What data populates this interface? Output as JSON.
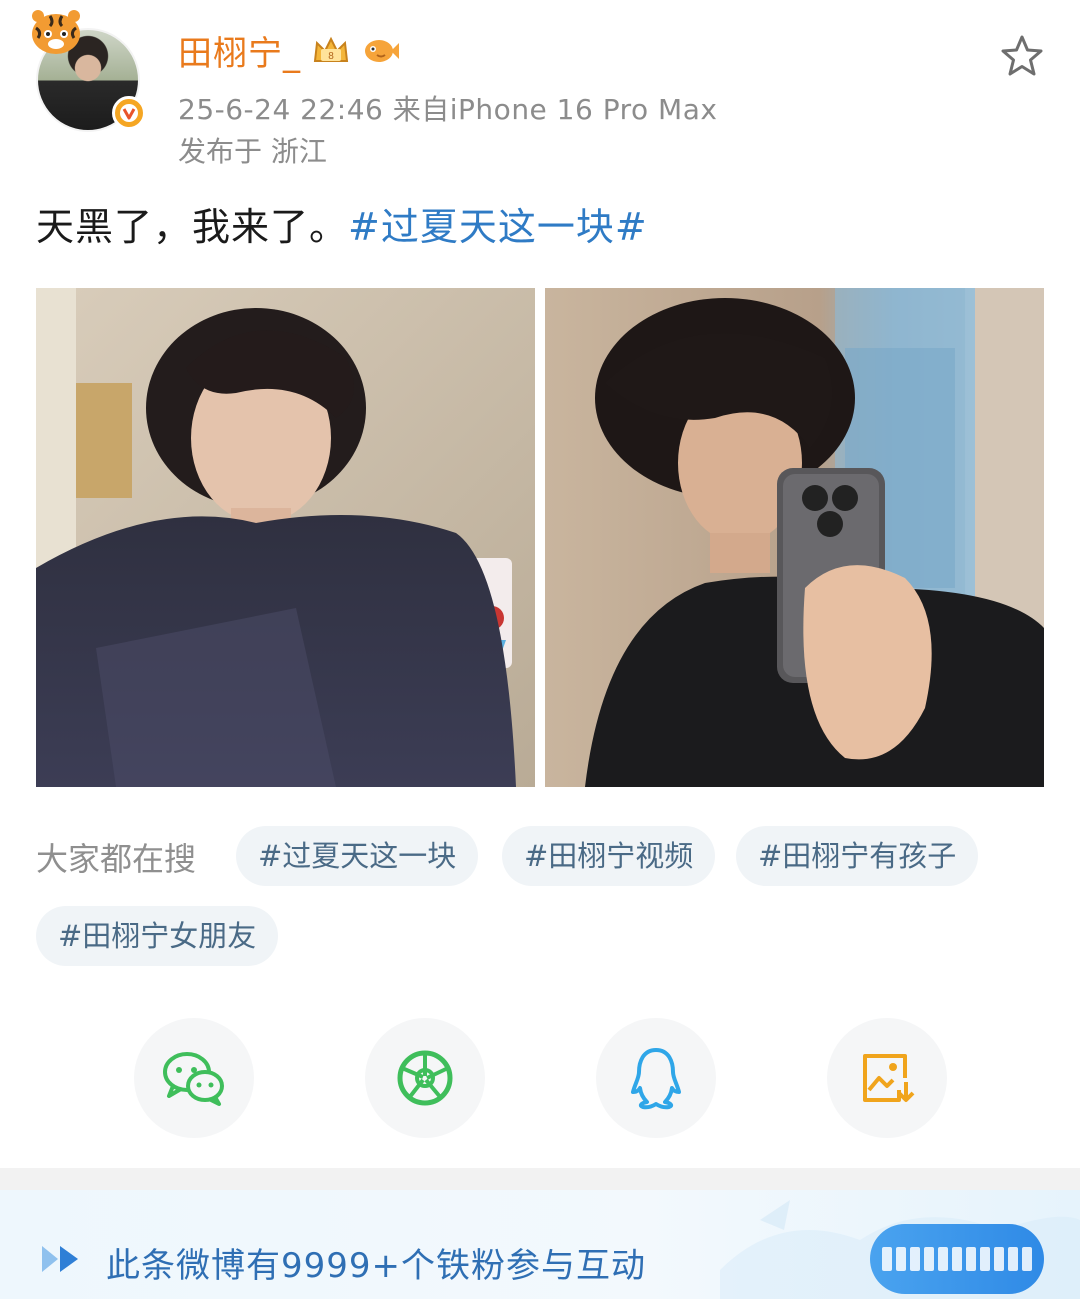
{
  "post": {
    "username": "田栩宁_",
    "time_source": "25-6-24 22:46  来自iPhone 16 Pro Max",
    "location": "发布于 浙江",
    "text": "天黑了，我来了。",
    "hashtag": "#过夏天这一块#"
  },
  "search": {
    "label": "大家都在搜",
    "chips": [
      "#过夏天这一块",
      "#田栩宁视频",
      "#田栩宁有孩子",
      "#田栩宁女朋友"
    ]
  },
  "share": {
    "buttons": [
      "wechat",
      "moments",
      "qq",
      "save-image"
    ]
  },
  "footer": {
    "text": "此条微博有9999+个铁粉参与互动"
  },
  "icons": {
    "star": "star-outline-icon",
    "verified": "verified-v-icon",
    "wechat": "wechat-icon",
    "moments": "moments-aperture-icon",
    "qq": "qq-penguin-icon",
    "save": "save-image-icon"
  },
  "colors": {
    "username": "#e97a1c",
    "hashtag": "#2f7bc5",
    "chip_text": "#4a6a86",
    "chip_bg": "#f0f4f7",
    "footer_text": "#2f6fb4",
    "wechat": "#3fbe5b",
    "moments": "#3fbe5b",
    "qq": "#2fa6e8",
    "save": "#f0a41c"
  }
}
